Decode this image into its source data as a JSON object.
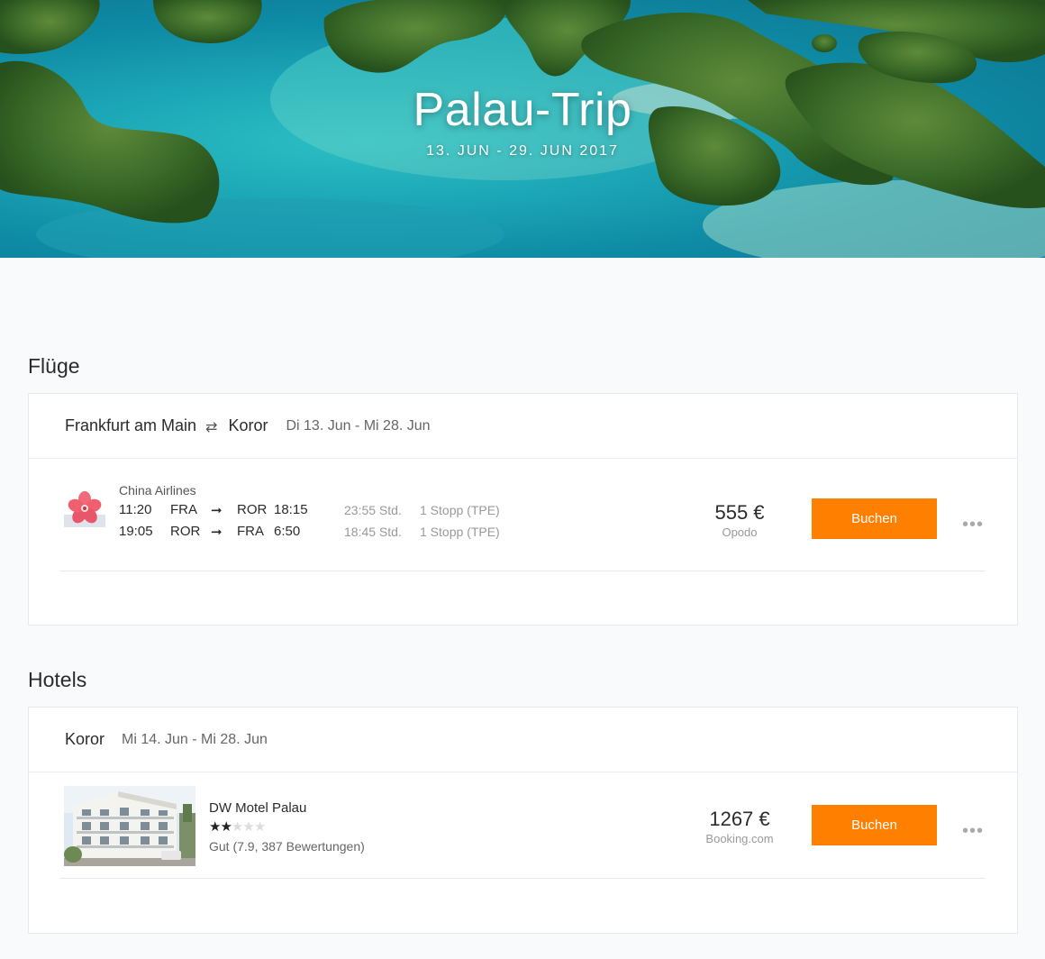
{
  "hero": {
    "title": "Palau-Trip",
    "dates": "13. JUN - 29. JUN 2017"
  },
  "flights": {
    "section_title": "Flüge",
    "route_from": "Frankfurt am Main",
    "route_to": "Koror",
    "route_dates": "Di 13. Jun - Mi 28. Jun",
    "airline": "China Airlines",
    "outbound": {
      "depart_time": "11:20",
      "from": "FRA",
      "to": "ROR",
      "arrive_time": "18:15",
      "duration": "23:55 Std.",
      "stops": "1 Stopp (TPE)"
    },
    "inbound": {
      "depart_time": "19:05",
      "from": "ROR",
      "to": "FRA",
      "arrive_time": "6:50",
      "duration": "18:45 Std.",
      "stops": "1 Stopp (TPE)"
    },
    "price": "555 €",
    "provider": "Opodo",
    "book_label": "Buchen",
    "more_label": "•••"
  },
  "hotels": {
    "section_title": "Hotels",
    "location": "Koror",
    "dates": "Mi 14. Jun - Mi 28. Jun",
    "name": "DW Motel Palau",
    "stars": 2,
    "max_stars": 5,
    "rating": "Gut (7.9, 387 Bewertungen)",
    "price": "1267 €",
    "provider": "Booking.com",
    "book_label": "Buchen",
    "more_label": "•••"
  },
  "icons": {
    "swap": "⇄",
    "arrow": "➞",
    "airline_logo": "plum-blossom-icon",
    "hotel_photo": "hotel-photo"
  },
  "colors": {
    "accent": "#ff7f00",
    "background": "#f9fafc"
  }
}
